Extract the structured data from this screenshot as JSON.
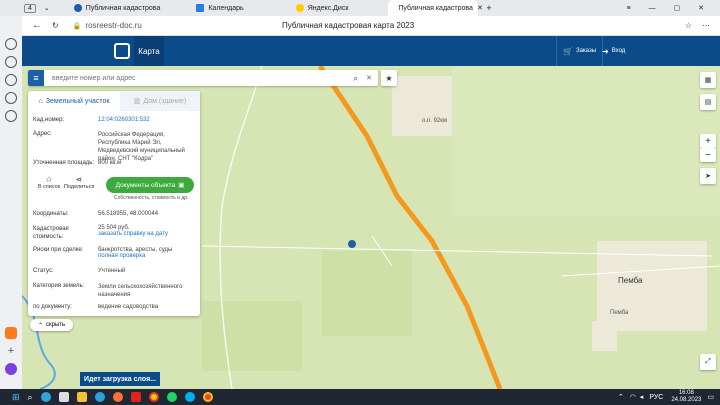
{
  "browser": {
    "tab_counter": "4",
    "tabs": [
      {
        "title": "Публичная кадастрова",
        "active": false
      },
      {
        "title": "Календарь",
        "active": false
      },
      {
        "title": "Яндекс.Диск",
        "active": false
      },
      {
        "title": "Публичная кадастрова",
        "active": true
      }
    ],
    "url": "rosreestr-doc.ru",
    "page_title": "Публичная кадастровая карта 2023"
  },
  "app": {
    "tab_map": "Карта",
    "orders": "Заказы",
    "login": "Вход"
  },
  "search": {
    "placeholder": "введите номер или адрес"
  },
  "panel": {
    "tab_parcel": "Земельный участок",
    "tab_building": "Дом (здание)",
    "rows": {
      "cad_label": "Кад.номер:",
      "cad_value": "12:04:0260301:532",
      "addr_label": "Адрес:",
      "addr_value": "Российская Федерация, Республика Марий Эл, Медведевский муниципальный район, СНТ \"Кодра\"",
      "area_label": "Уточненная площадь:",
      "area_value": "800 кв.м",
      "coord_label": "Координаты:",
      "coord_value": "56.518955, 48.000044",
      "cost_label": "Кадастровая стоимость:",
      "cost_value": "25 504 руб.",
      "cost_link": "заказать справку на дату",
      "risk_label": "Риски при сделке:",
      "risk_value": "банкротства, аресты, суды",
      "risk_link": "полная проверка",
      "status_label": "Статус:",
      "status_value": "Учтенный",
      "cat_label": "Категория земель:",
      "cat_value": "Земли сельскохозяйственного назначения",
      "doc_label": "по документу:",
      "doc_value": "ведение садоводства"
    },
    "btn_list": "В список",
    "btn_share": "Поделиться",
    "btn_docs": "Документы объекта",
    "btn_docs_sub": "Собственность, стоимость и др.",
    "hide": "скрыть"
  },
  "map": {
    "labels": {
      "pemba_big": "Пемба",
      "pemba_small": "Пемба",
      "station": "о.п. 92км"
    }
  },
  "taskbar": {
    "loading": "Идет загрузка слоя...",
    "lang": "РУС",
    "time": "16:08",
    "date": "24.08.2023"
  }
}
